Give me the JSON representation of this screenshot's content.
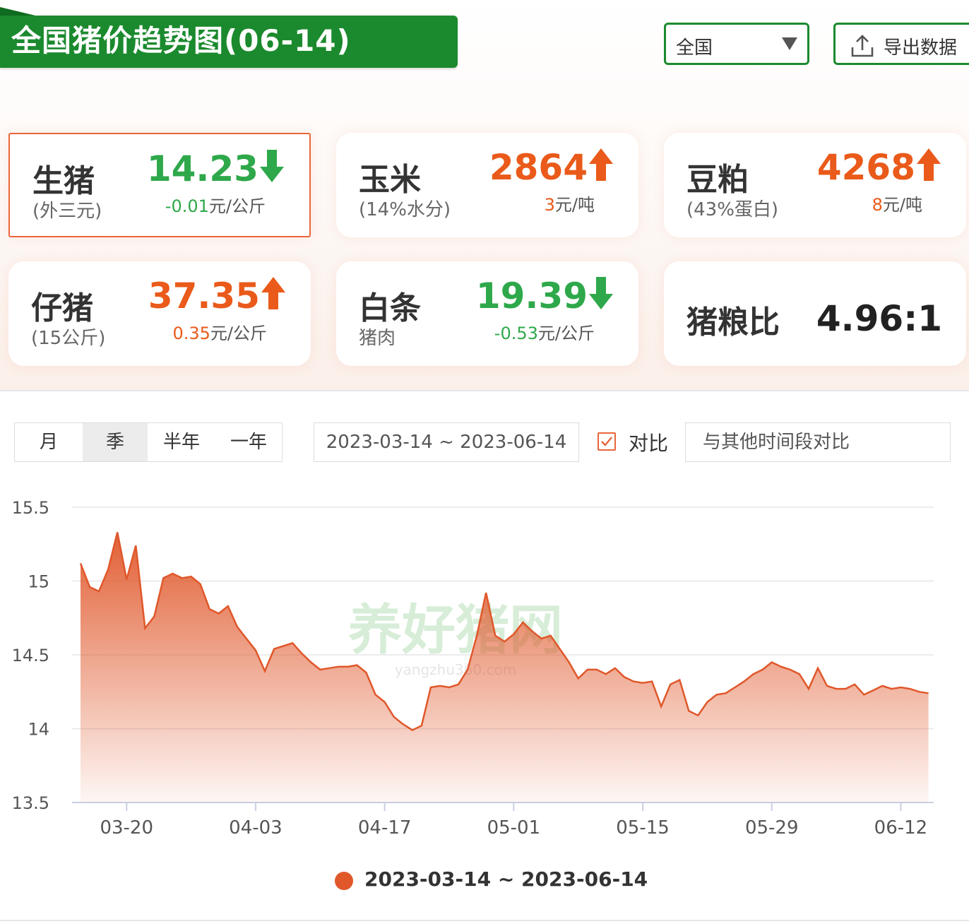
{
  "header": {
    "title": "全国猪价趋势图(06-14)",
    "region": "全国",
    "export_label": "导出数据"
  },
  "cards": [
    {
      "name": "生猪",
      "sub": "(外三元)",
      "price": "14.23",
      "trend": "down",
      "change": "-0.01",
      "unit": "元/公斤"
    },
    {
      "name": "玉米",
      "sub": "(14%水分)",
      "price": "2864",
      "trend": "up",
      "change": "3",
      "unit": "元/吨"
    },
    {
      "name": "豆粕",
      "sub": "(43%蛋白)",
      "price": "4268",
      "trend": "up",
      "change": "8",
      "unit": "元/吨"
    },
    {
      "name": "仔猪",
      "sub": "(15公斤)",
      "price": "37.35",
      "trend": "up",
      "change": "0.35",
      "unit": "元/公斤"
    },
    {
      "name": "白条",
      "sub": "猪肉",
      "price": "19.39",
      "trend": "down",
      "change": "-0.53",
      "unit": "元/公斤"
    }
  ],
  "ratio": {
    "name": "猪粮比",
    "value": "4.96:1"
  },
  "controls": {
    "tabs": [
      "月",
      "季",
      "半年",
      "一年"
    ],
    "active_tab": "季",
    "date_range": "2023-03-14 ~ 2023-06-14",
    "compare_label": "对比",
    "compare_checked": true,
    "compare_placeholder": "与其他时间段对比"
  },
  "colors": {
    "up": "#ea5a1a",
    "down": "#2ea84a",
    "series": "#e0572a",
    "brand": "#1b8a2e"
  },
  "chart_data": {
    "type": "area",
    "x_start": "2023-03-15",
    "x_ticks": [
      "03-20",
      "04-03",
      "04-17",
      "05-01",
      "05-15",
      "05-29",
      "06-12"
    ],
    "ylim": [
      13.5,
      15.5
    ],
    "y_ticks": [
      15.5,
      15,
      14.5,
      14,
      13.5
    ],
    "grid": true,
    "legend_position": "bottom",
    "series": [
      {
        "name": "2023-03-14 ~ 2023-06-14",
        "values": [
          15.12,
          14.96,
          14.93,
          15.08,
          15.33,
          15.01,
          15.24,
          14.68,
          14.76,
          15.02,
          15.05,
          15.02,
          15.03,
          14.98,
          14.81,
          14.78,
          14.83,
          14.69,
          14.61,
          14.53,
          14.39,
          14.54,
          14.56,
          14.58,
          14.51,
          14.45,
          14.4,
          14.41,
          14.42,
          14.42,
          14.43,
          14.38,
          14.23,
          14.18,
          14.08,
          14.03,
          13.99,
          14.02,
          14.28,
          14.29,
          14.28,
          14.3,
          14.4,
          14.63,
          14.92,
          14.63,
          14.59,
          14.64,
          14.72,
          14.66,
          14.61,
          14.63,
          14.54,
          14.45,
          14.34,
          14.4,
          14.4,
          14.37,
          14.41,
          14.35,
          14.32,
          14.31,
          14.32,
          14.15,
          14.3,
          14.33,
          14.12,
          14.09,
          14.18,
          14.23,
          14.24,
          14.28,
          14.32,
          14.37,
          14.4,
          14.45,
          14.42,
          14.4,
          14.37,
          14.27,
          14.41,
          14.29,
          14.27,
          14.27,
          14.3,
          14.23,
          14.26,
          14.29,
          14.27,
          14.28,
          14.27,
          14.25,
          14.24
        ]
      }
    ]
  },
  "watermark": {
    "text": "养好猪网",
    "url": "yangzhu360.com"
  }
}
